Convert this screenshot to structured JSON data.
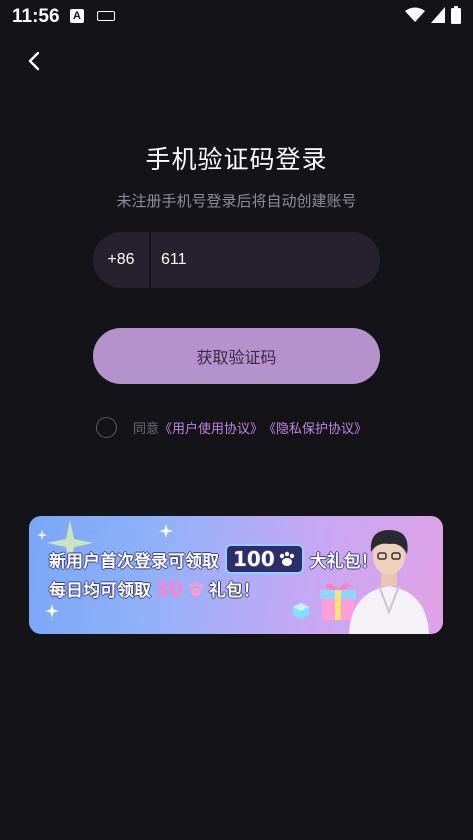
{
  "status_bar": {
    "time": "11:56",
    "icons": [
      "a-notification-icon",
      "keyboard-icon",
      "wifi-icon",
      "signal-icon",
      "battery-icon"
    ]
  },
  "header": {
    "back_icon": "chevron-left-icon"
  },
  "login": {
    "title": "手机验证码登录",
    "subtitle": "未注册手机号登录后将自动创建账号",
    "country_code": "+86",
    "phone_value": "611",
    "get_code_label": "获取验证码"
  },
  "agreement": {
    "prefix": "同意",
    "user_agreement": "《用户使用协议》",
    "privacy_agreement": "《隐私保护协议》"
  },
  "banner": {
    "line1_prefix": "新用户首次登录可领取",
    "line1_amount": "100",
    "line1_suffix": "大礼包！",
    "line2_prefix": "每日均可领取",
    "line2_amount": "30",
    "line2_suffix": "礼包！"
  },
  "colors": {
    "background": "#141418",
    "input_background": "#27212f",
    "button": "#b592cc",
    "link": "#c084e0"
  }
}
